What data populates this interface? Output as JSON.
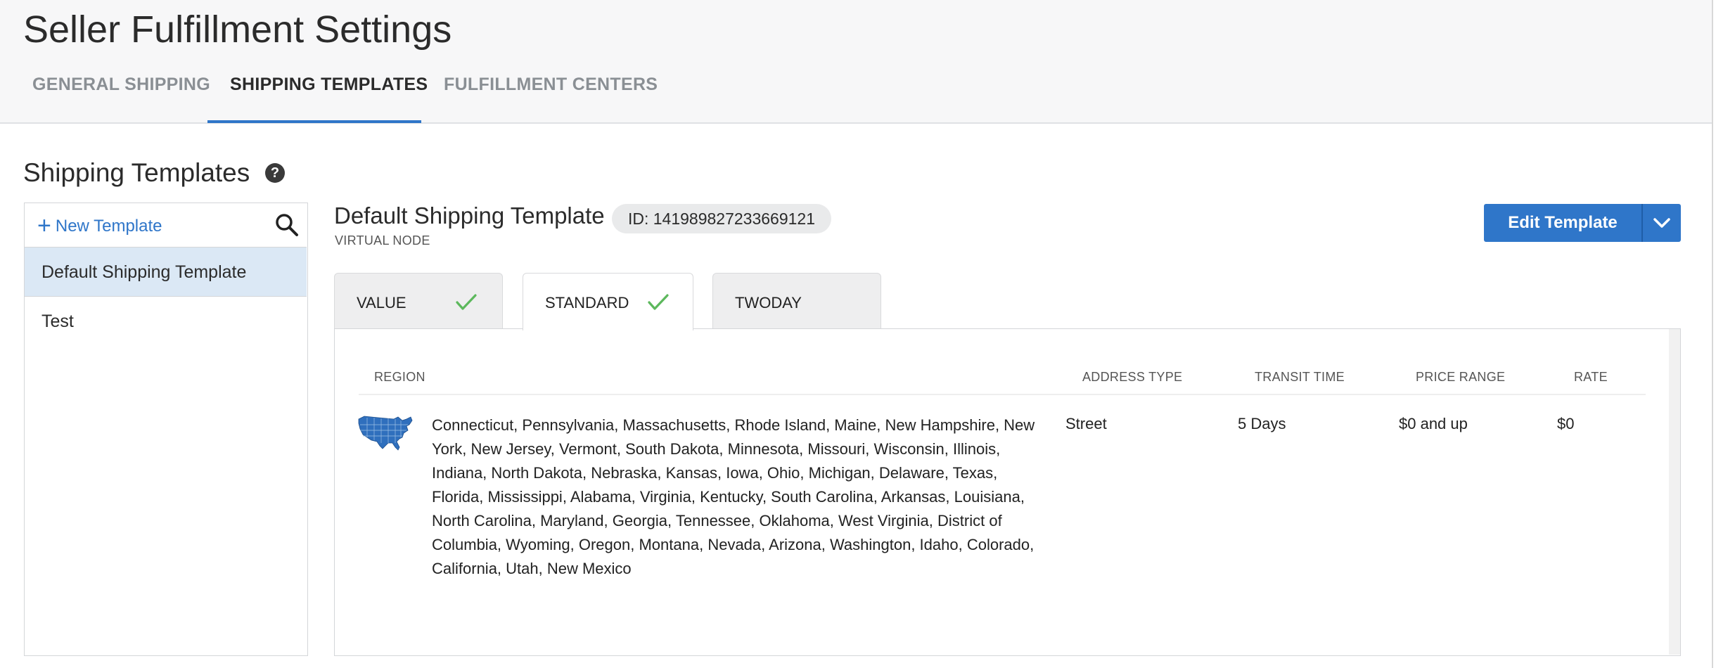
{
  "page": {
    "title": "Seller Fulfillment Settings"
  },
  "tabs": [
    {
      "label": "GENERAL SHIPPING",
      "active": false
    },
    {
      "label": "SHIPPING TEMPLATES",
      "active": true
    },
    {
      "label": "FULFILLMENT CENTERS",
      "active": false
    }
  ],
  "section": {
    "title": "Shipping Templates",
    "help_icon": "question-circle-icon"
  },
  "left_panel": {
    "new_template_label": "New Template",
    "plus_icon": "plus-icon",
    "search_icon": "search-icon",
    "templates": [
      {
        "label": "Default Shipping Template",
        "selected": true
      },
      {
        "label": "Test",
        "selected": false
      }
    ]
  },
  "detail": {
    "title": "Default Shipping Template",
    "subtitle": "VIRTUAL NODE",
    "id_label": "ID: 141989827233669121",
    "edit_button_label": "Edit Template",
    "edit_dropdown_icon": "chevron-down-icon"
  },
  "service_tabs": [
    {
      "label": "VALUE",
      "configured": true,
      "active": false
    },
    {
      "label": "STANDARD",
      "configured": true,
      "active": true
    },
    {
      "label": "TWODAY",
      "configured": false,
      "active": false
    }
  ],
  "table": {
    "headers": {
      "region": "REGION",
      "address_type": "ADDRESS TYPE",
      "transit_time": "TRANSIT TIME",
      "price_range": "PRICE RANGE",
      "rate": "RATE"
    },
    "rows": [
      {
        "region_icon": "usa-map-icon",
        "region": "Connecticut, Pennsylvania, Massachusetts, Rhode Island, Maine, New Hampshire, New York, New Jersey, Vermont, South Dakota, Minnesota, Missouri, Wisconsin, Illinois, Indiana, North Dakota, Nebraska, Kansas, Iowa, Ohio, Michigan, Delaware, Texas, Florida, Mississippi, Alabama, Virginia, Kentucky, South Carolina, Arkansas, Louisiana, North Carolina, Maryland, Georgia, Tennessee, Oklahoma, West Virginia, District of Columbia, Wyoming, Oregon, Montana, Nevada, Arizona, Washington, Idaho, Colorado, California, Utah, New Mexico",
        "address_type": "Street",
        "transit_time": "5 Days",
        "price_range": "$0 and up",
        "rate": "$0"
      }
    ]
  },
  "colors": {
    "accent": "#2f76c9",
    "check": "#5cb85c",
    "selected_row": "#dbe8f5"
  }
}
